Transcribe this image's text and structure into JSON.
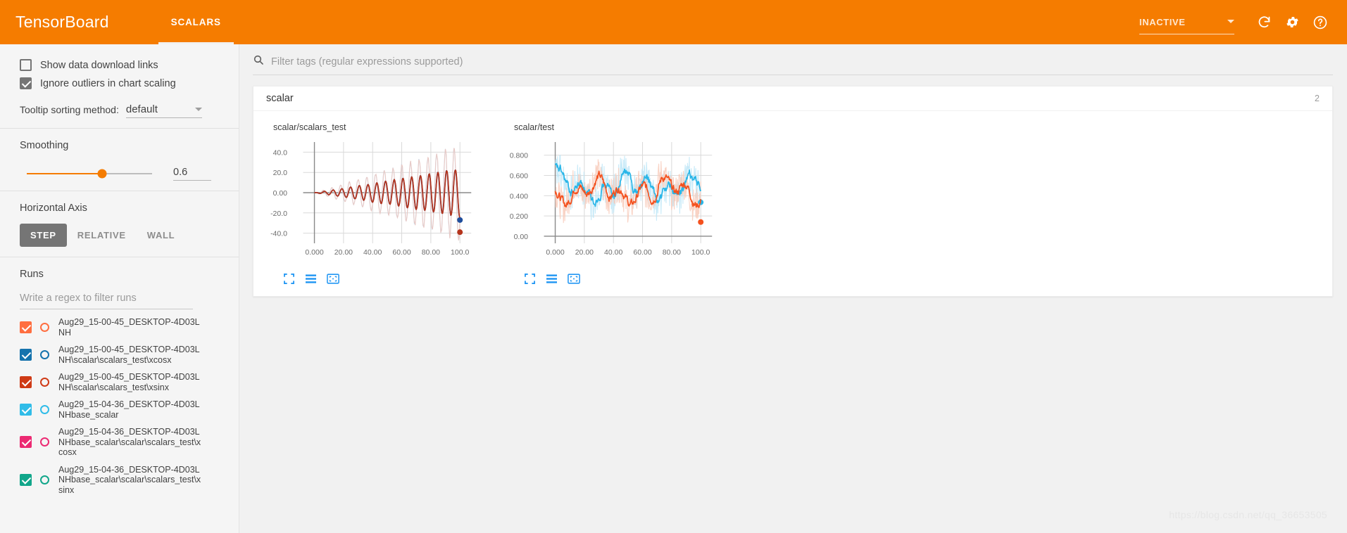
{
  "header": {
    "brand": "TensorBoard",
    "tabs": [
      {
        "label": "SCALARS",
        "active": true
      }
    ],
    "run_selector": {
      "value": "INACTIVE",
      "icon": "chevron-down-icon"
    },
    "actions": [
      {
        "name": "refresh-icon",
        "label": "Refresh"
      },
      {
        "name": "gear-icon",
        "label": "Settings"
      },
      {
        "name": "help-icon",
        "label": "Help"
      }
    ],
    "accent_color": "#f57c00"
  },
  "sidebar": {
    "checkboxes": [
      {
        "label": "Show data download links",
        "checked": false
      },
      {
        "label": "Ignore outliers in chart scaling",
        "checked": true
      }
    ],
    "tooltip_sorting": {
      "label": "Tooltip sorting method:",
      "value": "default"
    },
    "smoothing": {
      "title": "Smoothing",
      "value": "0.6",
      "fraction": 0.6
    },
    "horizontal_axis": {
      "title": "Horizontal Axis",
      "options": [
        "STEP",
        "RELATIVE",
        "WALL"
      ],
      "selected": "STEP"
    },
    "runs": {
      "title": "Runs",
      "filter_placeholder": "Write a regex to filter runs",
      "items": [
        {
          "label": "Aug29_15-00-45_DESKTOP-4D03LNH",
          "color": "#ff6e40",
          "checked": true
        },
        {
          "label": "Aug29_15-00-45_DESKTOP-4D03LNH\\scalar\\scalars_test\\xcosx",
          "color": "#1573ad",
          "checked": true
        },
        {
          "label": "Aug29_15-00-45_DESKTOP-4D03LNH\\scalar\\scalars_test\\xsinx",
          "color": "#cf3a16",
          "checked": true
        },
        {
          "label": "Aug29_15-04-36_DESKTOP-4D03LNHbase_scalar",
          "color": "#30bce8",
          "checked": true
        },
        {
          "label": "Aug29_15-04-36_DESKTOP-4D03LNHbase_scalar\\scalar\\scalars_test\\xcosx",
          "color": "#ec2a72",
          "checked": true
        },
        {
          "label": "Aug29_15-04-36_DESKTOP-4D03LNHbase_scalar\\scalar\\scalars_test\\xsinx",
          "color": "#11a68a",
          "checked": true
        }
      ]
    }
  },
  "main": {
    "tag_filter": {
      "placeholder": "Filter tags (regular expressions supported)",
      "icon": "search-icon",
      "value": ""
    },
    "card": {
      "title": "scalar",
      "count": "2"
    },
    "chart_tools": [
      "expand-icon",
      "data-series-icon",
      "fit-domain-icon"
    ],
    "watermark": "https://blog.csdn.net/qq_36653505"
  },
  "chart_data": [
    {
      "type": "line",
      "title": "scalar/scalars_test",
      "xlabel": "",
      "ylabel": "",
      "xlim": [
        -8,
        112
      ],
      "ylim": [
        -50,
        50
      ],
      "xticks": [
        "0.000",
        "20.00",
        "40.00",
        "60.00",
        "80.00",
        "100.0"
      ],
      "xtick_values": [
        0,
        20,
        40,
        60,
        80,
        100
      ],
      "yticks": [
        "40.0",
        "20.0",
        "0.00",
        "-20.0",
        "-40.0"
      ],
      "ytick_values": [
        40,
        20,
        0,
        -20,
        -40
      ],
      "grid": true,
      "smoothing": 0.6,
      "series": [
        {
          "name": "xcosx",
          "color": "#1f4e9c",
          "ghost_color": "#b8d1ea",
          "shape": "damped_growing_cos",
          "amplitude_end": 46,
          "period": 6.0,
          "phase": 0.0,
          "last_point": {
            "x": 100,
            "y": -27
          }
        },
        {
          "name": "xsinx",
          "color": "#b5341c",
          "ghost_color": "#f0c7bd",
          "shape": "damped_growing_sin",
          "amplitude_end": 46,
          "period": 6.0,
          "phase": 1.5,
          "last_point": {
            "x": 100,
            "y": -39
          }
        }
      ]
    },
    {
      "type": "line",
      "title": "scalar/test",
      "xlabel": "",
      "ylabel": "",
      "xlim": [
        -8,
        112
      ],
      "ylim": [
        -0.07,
        0.93
      ],
      "xticks": [
        "0.000",
        "20.00",
        "40.00",
        "60.00",
        "80.00",
        "100.0"
      ],
      "xtick_values": [
        0,
        20,
        40,
        60,
        80,
        100
      ],
      "yticks": [
        "0.800",
        "0.600",
        "0.400",
        "0.200",
        "0.00"
      ],
      "ytick_values": [
        0.8,
        0.6,
        0.4,
        0.2,
        0.0
      ],
      "grid": true,
      "smoothing": 0.6,
      "series": [
        {
          "name": "base_scalar-blue",
          "color": "#29b6e8",
          "ghost_color": "#bee6f7",
          "shape": "noise",
          "mean": 0.48,
          "spread": 0.2,
          "seed": 7,
          "last_point": {
            "x": 100,
            "y": 0.335
          }
        },
        {
          "name": "base_scalar-orange",
          "color": "#f4511e",
          "ghost_color": "#f8cbbb",
          "shape": "noise",
          "mean": 0.45,
          "spread": 0.18,
          "seed": 21,
          "last_point": {
            "x": 100,
            "y": 0.14
          }
        }
      ]
    }
  ]
}
